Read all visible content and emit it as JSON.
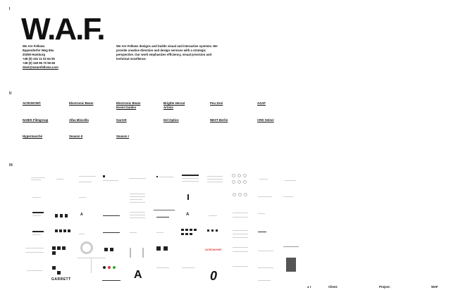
{
  "sections": {
    "one": "I",
    "two": "II",
    "three": "III"
  },
  "brand": {
    "logo": "W.A.F."
  },
  "address": {
    "lines": [
      "We Are Fellows",
      "Eppendorfer Weg 65a",
      "20259 Hamburg",
      "+49 (0) 151 11 02 64 55",
      "+49 (0) 160 96 70 59 66"
    ],
    "email": "desk@wearefellows.com"
  },
  "about": "We Are Fellows designs and builds visual and interactive systems. We provide creative direction and design services with a strategic perspective. Our work emphasizes efficiency, visual precision and technical excellence.",
  "clients": [
    "ACRONYM®",
    "Electronic Beats",
    "Electronic Beats\nEvent Guides",
    "Brigitte Hervat\nArtists",
    "Peu Zeni",
    "ASAF",
    "NABIS Filmgroup",
    "Alba Miscella",
    "Garrett",
    "Del Optics",
    "NEXT Berlin",
    "CRD Select",
    "Hypermarché",
    "Season II",
    "Season I"
  ],
  "thumb_labels": {
    "garrett": "GARRETT",
    "acronym": "ACRONYM®",
    "zero": "0",
    "a_glyph": "A"
  },
  "footer": {
    "index": "● I",
    "client": "Client:",
    "project": "Project:",
    "counter": "WAF"
  },
  "colors": {
    "accent": "#dd3333",
    "text": "#111111"
  }
}
